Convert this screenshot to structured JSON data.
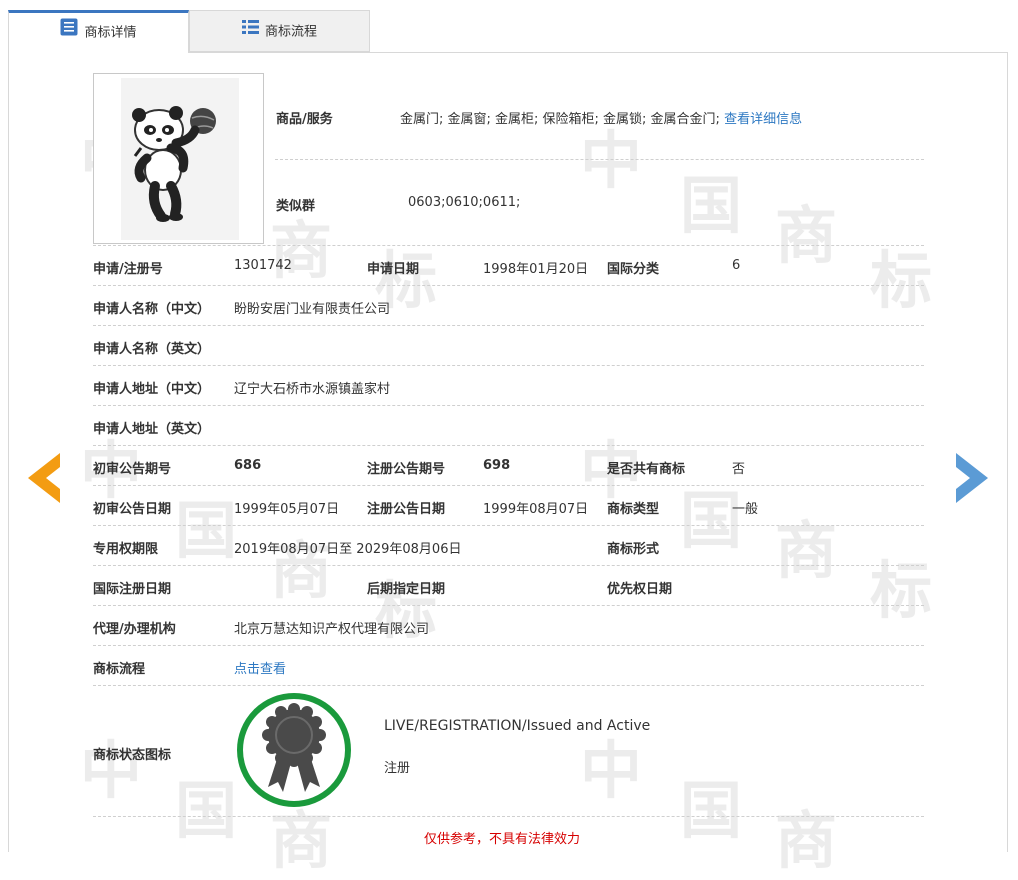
{
  "tabs": [
    {
      "label": "商标详情"
    },
    {
      "label": "商标流程"
    }
  ],
  "top": {
    "goods_label": "商品/服务",
    "goods_value": "金属门; 金属窗; 金属柜; 保险箱柜; 金属锁; 金属合金门;",
    "goods_link": "查看详细信息",
    "similar_label": "类似群",
    "similar_value": "0603;0610;0611;"
  },
  "rows": {
    "reg_no_label": "申请/注册号",
    "reg_no": "1301742",
    "apply_date_label": "申请日期",
    "apply_date": "1998年01月20日",
    "intl_class_label": "国际分类",
    "intl_class": "6",
    "applicant_cn_label": "申请人名称（中文）",
    "applicant_cn": "盼盼安居门业有限责任公司",
    "applicant_en_label": "申请人名称（英文）",
    "address_cn_label": "申请人地址（中文）",
    "address_cn": "辽宁大石桥市水源镇盖家村",
    "address_en_label": "申请人地址（英文）",
    "prelim_no_label": "初审公告期号",
    "prelim_no": "686",
    "reg_ann_no_label": "注册公告期号",
    "reg_ann_no": "698",
    "shared_label": "是否共有商标",
    "shared": "否",
    "prelim_date_label": "初审公告日期",
    "prelim_date": "1999年05月07日",
    "reg_ann_date_label": "注册公告日期",
    "reg_ann_date": "1999年08月07日",
    "tm_type_label": "商标类型",
    "tm_type": "一般",
    "term_label": "专用权期限",
    "term": "2019年08月07日至 2029年08月06日",
    "tm_form_label": "商标形式",
    "intl_reg_date_label": "国际注册日期",
    "later_date_label": "后期指定日期",
    "priority_date_label": "优先权日期",
    "agent_label": "代理/办理机构",
    "agent": "北京万慧达知识产权代理有限公司",
    "flow_label": "商标流程",
    "flow_link": "点击查看",
    "status_icon_label": "商标状态图标",
    "status_en": "LIVE/REGISTRATION/Issued and Active",
    "status_cn": "注册"
  },
  "notice": "仅供参考，不具有法律效力",
  "colors": {
    "accent": "#3b76c0",
    "link": "#2d78c2",
    "left_arrow": "#f39c12",
    "right_arrow": "#5b9bd5",
    "badge_ring": "#1a9a3c",
    "notice": "#d60000"
  }
}
